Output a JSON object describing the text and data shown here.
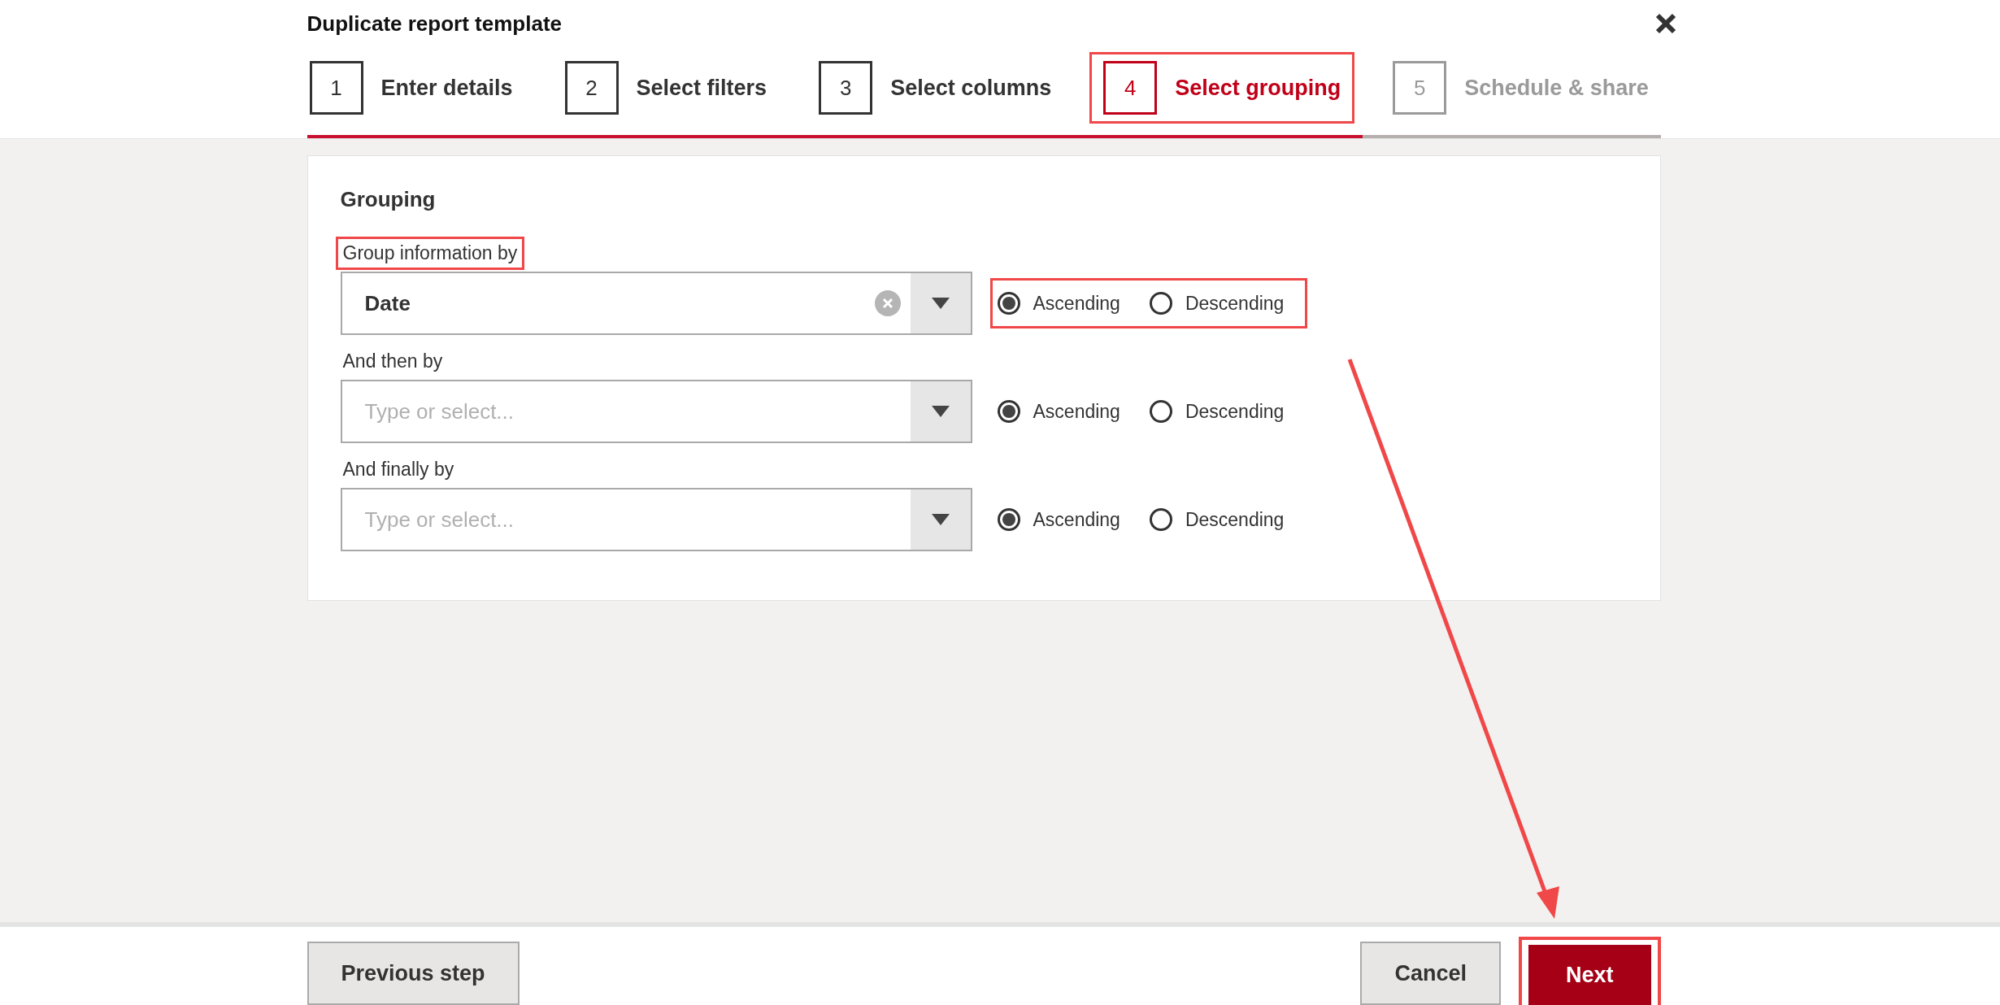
{
  "dialog": {
    "title": "Duplicate report template"
  },
  "steps": [
    {
      "number": "1",
      "label": "Enter details",
      "selected": false,
      "disabled": false,
      "highlighted": false
    },
    {
      "number": "2",
      "label": "Select filters",
      "selected": false,
      "disabled": false,
      "highlighted": false
    },
    {
      "number": "3",
      "label": "Select columns",
      "selected": false,
      "disabled": false,
      "highlighted": false
    },
    {
      "number": "4",
      "label": "Select grouping",
      "selected": true,
      "disabled": false,
      "highlighted": true
    },
    {
      "number": "5",
      "label": "Schedule & share",
      "selected": false,
      "disabled": true,
      "highlighted": false
    }
  ],
  "progress": {
    "level": 0.78
  },
  "grouping": {
    "heading": "Grouping",
    "rows": [
      {
        "label": "Group information by",
        "label_highlighted": true,
        "value": "Date",
        "options_highlighted": true,
        "sort": [
          {
            "label": "Ascending",
            "selected": true
          },
          {
            "label": "Descending",
            "selected": false
          }
        ]
      },
      {
        "label": "And then by",
        "label_highlighted": false,
        "placeholder": "Type or select...",
        "options_highlighted": false,
        "sort": [
          {
            "label": "Ascending",
            "selected": true
          },
          {
            "label": "Descending",
            "selected": false
          }
        ]
      },
      {
        "label": "And finally by",
        "label_highlighted": false,
        "placeholder": "Type or select...",
        "options_highlighted": false,
        "sort": [
          {
            "label": "Ascending",
            "selected": true
          },
          {
            "label": "Descending",
            "selected": false
          }
        ]
      }
    ]
  },
  "footer": {
    "previous": "Previous step",
    "cancel": "Cancel",
    "next": "Next",
    "next_highlighted": true
  },
  "annotation_arrow": true
}
